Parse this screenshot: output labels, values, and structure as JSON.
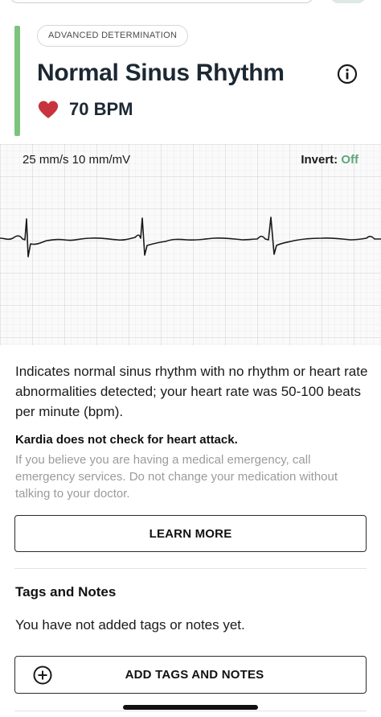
{
  "result": {
    "badge": "ADVANCED DETERMINATION",
    "title": "Normal Sinus Rhythm",
    "heart_rate": "70 BPM",
    "accent_color": "#7cc47b"
  },
  "ecg": {
    "scale": "25 mm/s  10 mm/mV",
    "invert_label": "Invert: ",
    "invert_value": "Off"
  },
  "description": "Indicates normal sinus rhythm with no rhythm or heart rate abnormalities detected; your heart rate was 50-100 beats per minute (bpm).",
  "warning": {
    "title": "Kardia does not check for heart attack.",
    "text": "If you believe you are having a medical emergency, call emergency services. Do not change your medication without talking to your doctor."
  },
  "learn_more_label": "LEARN MORE",
  "tags": {
    "title": "Tags and Notes",
    "empty_text": "You have not added tags or notes yet.",
    "add_label": "ADD TAGS AND NOTES"
  },
  "icons": {
    "info": "info-icon",
    "heart": "heart-icon",
    "add": "plus-circle-icon"
  }
}
